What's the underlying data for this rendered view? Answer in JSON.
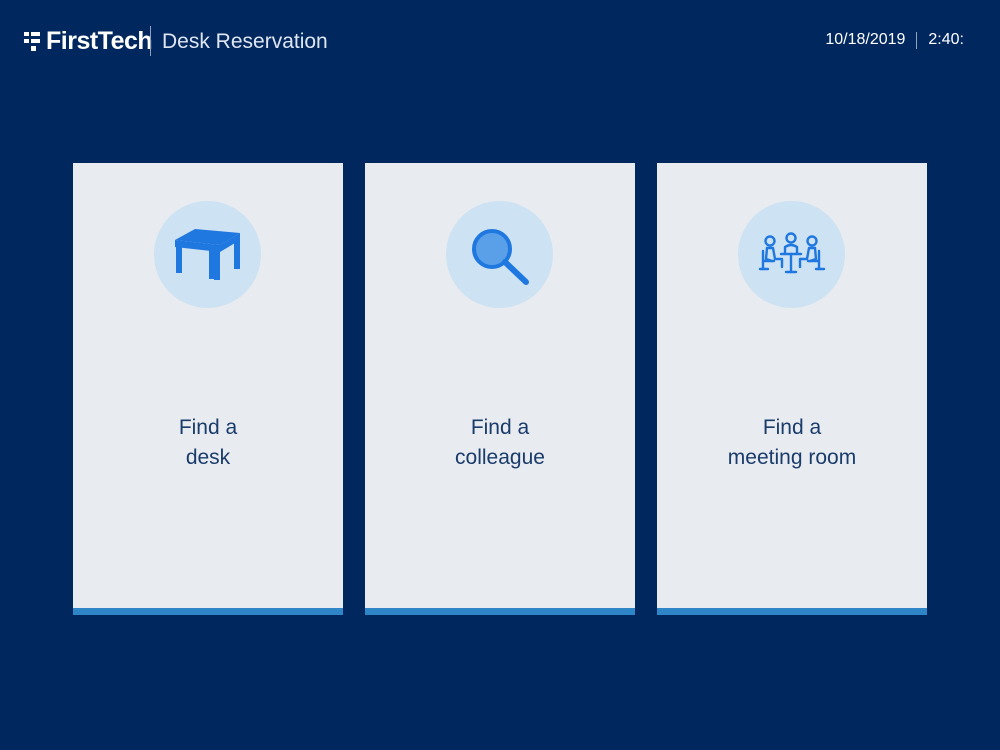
{
  "header": {
    "brand": "FirstTech",
    "app_title": "Desk Reservation",
    "date": "10/18/2019",
    "time": "2:40:"
  },
  "cards": [
    {
      "line1": "Find a",
      "line2": "desk",
      "icon": "desk-icon"
    },
    {
      "line1": "Find a",
      "line2": "colleague",
      "icon": "magnifier-icon"
    },
    {
      "line1": "Find a",
      "line2": "meeting room",
      "icon": "meeting-icon"
    }
  ],
  "colors": {
    "background": "#00285e",
    "card": "#e8ebef",
    "accent_bar": "#2e86c8",
    "icon_circle": "#cde2f2",
    "icon": "#1f77e0",
    "label_text": "#1a3c6c"
  }
}
